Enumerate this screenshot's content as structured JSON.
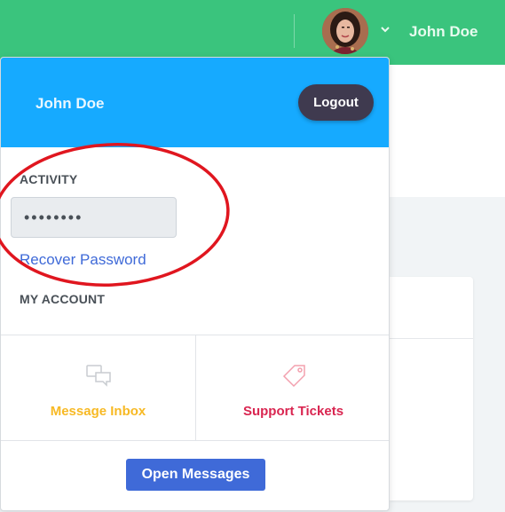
{
  "topbar": {
    "username": "John Doe",
    "bg_color": "#3ac47d",
    "chevron_icon": "chevron-down-icon"
  },
  "dropdown": {
    "header": {
      "name": "John Doe",
      "logout_label": "Logout",
      "bg_color": "#16aaff"
    },
    "activity_label": "ACTIVITY",
    "password_value": "••••••••",
    "recover_label": "Recover Password",
    "my_account_label": "MY ACCOUNT",
    "grid": [
      {
        "label": "Message Inbox",
        "icon": "chat-bubbles-icon",
        "color": "#f7b924"
      },
      {
        "label": "Support Tickets",
        "icon": "tag-icon",
        "color": "#d92550"
      }
    ],
    "open_messages_label": "Open Messages"
  },
  "annotation": {
    "shape": "ellipse",
    "color": "#e0161f"
  }
}
